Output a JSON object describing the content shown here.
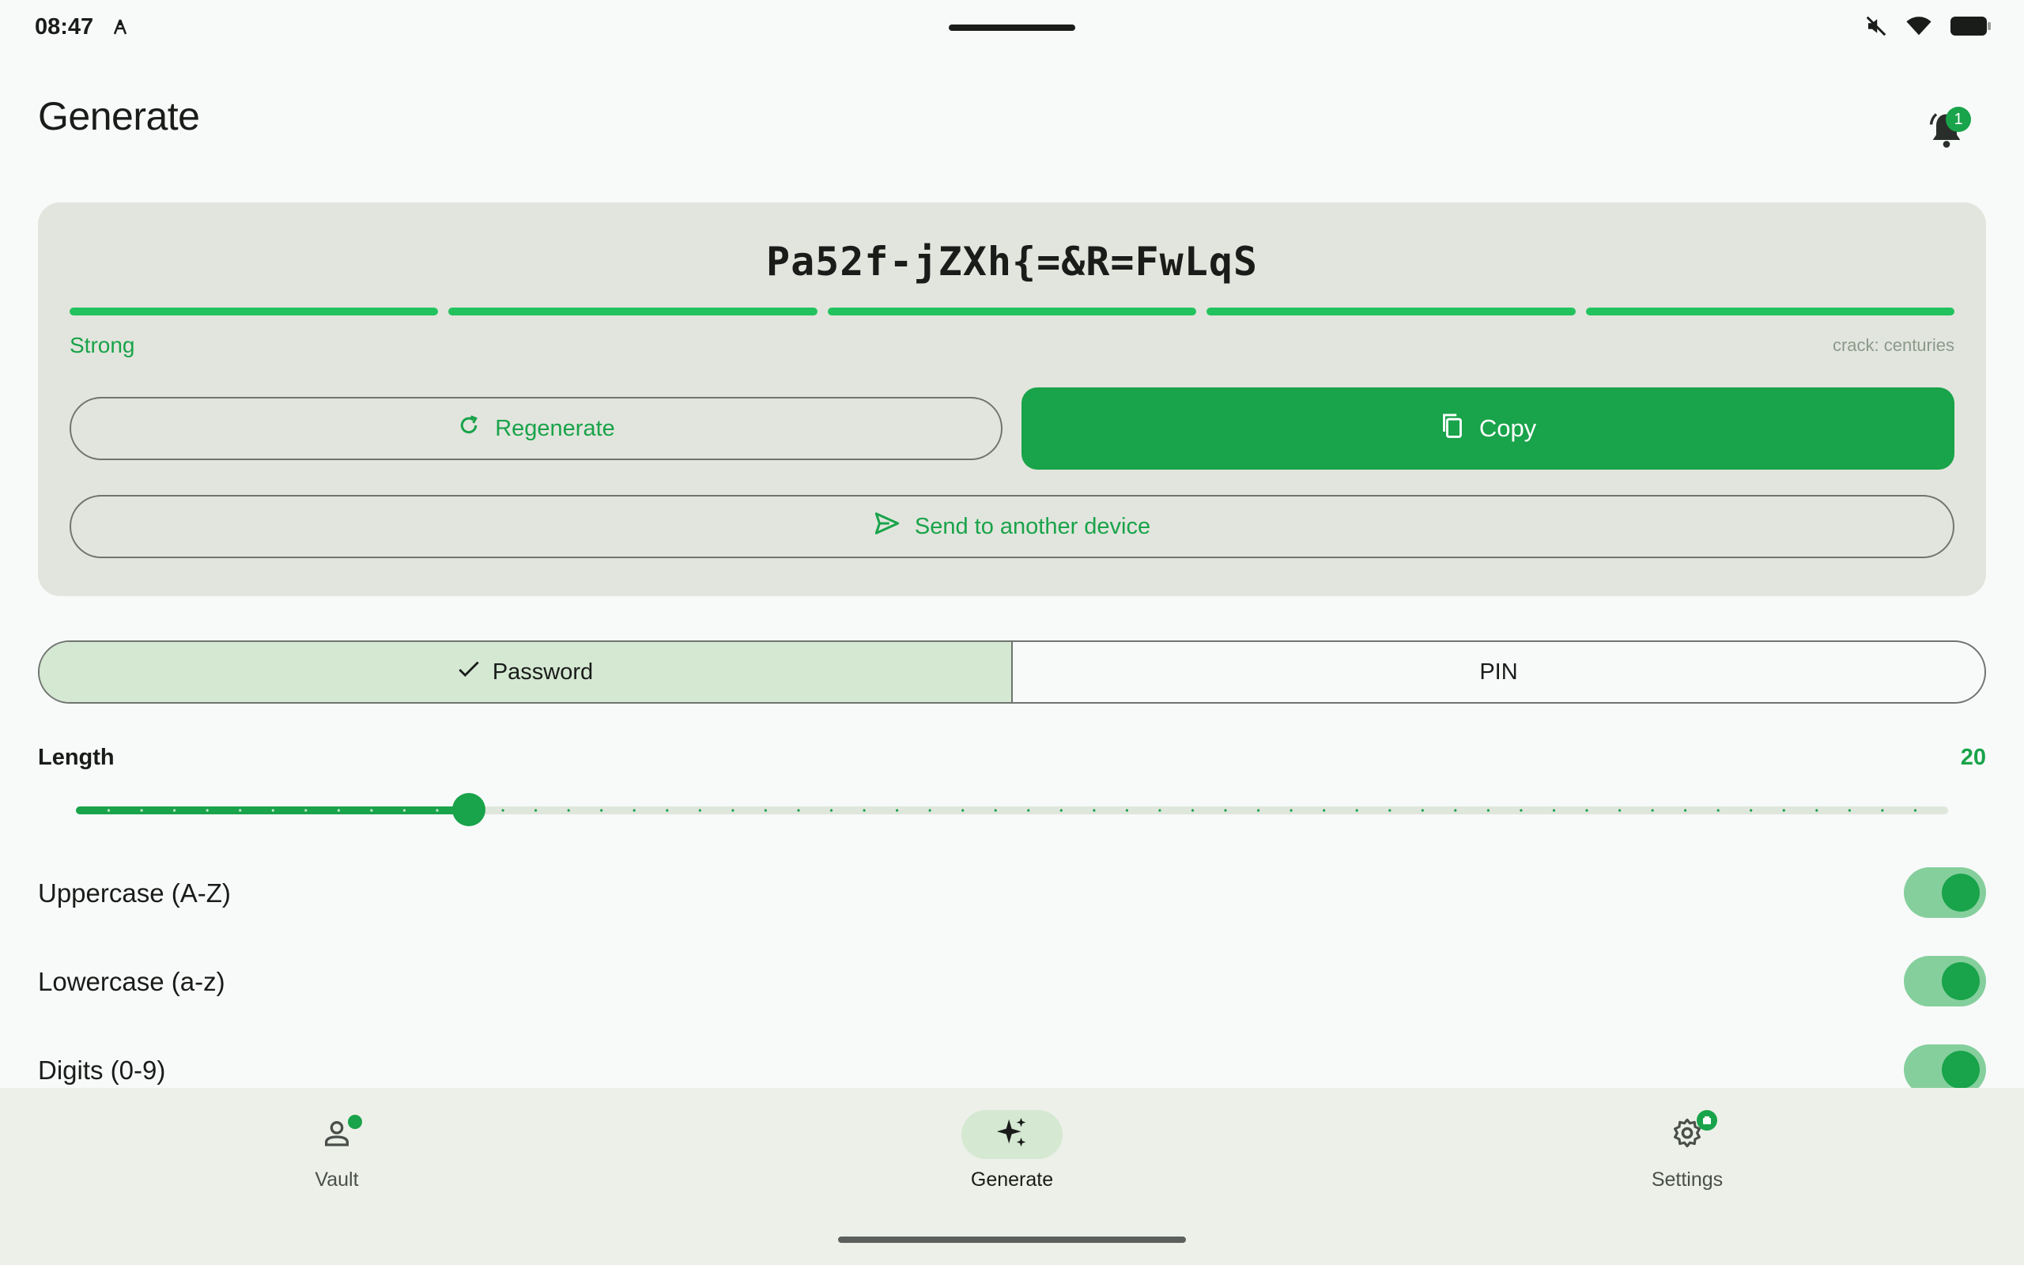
{
  "status_bar": {
    "time": "08:47"
  },
  "header": {
    "title": "Generate",
    "notification_count": "1"
  },
  "generator": {
    "password": "Pa52f-jZXh{=&R=FwLqS",
    "strength_label": "Strong",
    "strength_segments_filled": 5,
    "strength_segments_total": 5,
    "crack_time": "crack: centuries",
    "regenerate_label": "Regenerate",
    "copy_label": "Copy",
    "send_label": "Send to another device"
  },
  "mode": {
    "options": [
      "Password",
      "PIN"
    ],
    "selected": "Password"
  },
  "length": {
    "label": "Length",
    "value": "20",
    "fraction": 0.21
  },
  "options": [
    {
      "label": "Uppercase (A-Z)",
      "enabled": true
    },
    {
      "label": "Lowercase (a-z)",
      "enabled": true
    },
    {
      "label": "Digits (0-9)",
      "enabled": true
    }
  ],
  "bottom_nav": {
    "items": [
      {
        "label": "Vault",
        "icon": "person-icon"
      },
      {
        "label": "Generate",
        "icon": "sparkle-icon"
      },
      {
        "label": "Settings",
        "icon": "gear-icon"
      }
    ],
    "active": "Generate"
  },
  "colors": {
    "accent": "#19a34a",
    "strength": "#22c35e",
    "card_bg": "#e2e5dd",
    "selected_segment": "#d4e8d2"
  }
}
